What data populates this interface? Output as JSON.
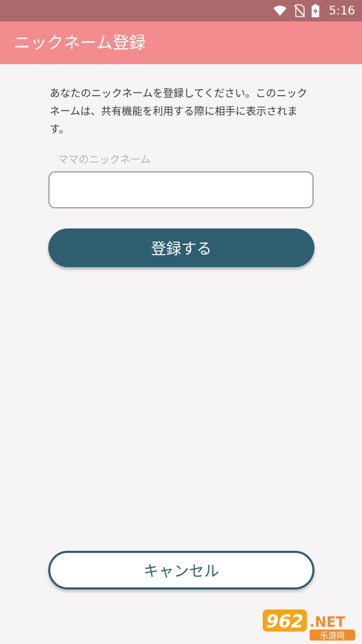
{
  "status_bar": {
    "time": "5:16",
    "icons": [
      "wifi-icon",
      "no-sim-icon",
      "battery-charging-icon"
    ]
  },
  "app_bar": {
    "title": "ニックネーム登録",
    "background": "#f28c8e"
  },
  "main": {
    "intro_text": "あなたのニックネームを登録してください。このニックネームは、共有機能を利用する際に相手に表示されます。",
    "nickname_label": "ママのニックネーム",
    "nickname_value": "",
    "register_label": "登録する",
    "cancel_label": "キャンセル"
  },
  "watermark": {
    "brand": "962.NET",
    "subtitle": "乐游网"
  },
  "colors": {
    "status_bar": "#ad686b",
    "primary": "#2e5e70",
    "background": "#f7f4f5"
  }
}
